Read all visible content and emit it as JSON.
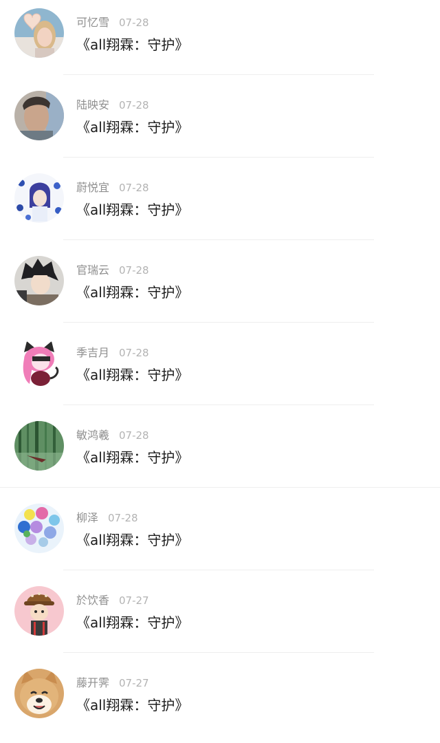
{
  "comments": [
    {
      "name": "可忆雪",
      "date": "07-28",
      "text": "《all翔霖：守护》",
      "avatar_icon": "girl-heart-hands-avatar"
    },
    {
      "name": "陆映安",
      "date": "07-28",
      "text": "《all翔霖：守护》",
      "avatar_icon": "boy-photo-avatar"
    },
    {
      "name": "蔚悦宜",
      "date": "07-28",
      "text": "《all翔霖：守护》",
      "avatar_icon": "anime-blue-butterflies-avatar"
    },
    {
      "name": "官瑞云",
      "date": "07-28",
      "text": "《all翔霖：守护》",
      "avatar_icon": "anime-dark-hair-boy-avatar"
    },
    {
      "name": "季吉月",
      "date": "07-28",
      "text": "《all翔霖：守护》",
      "avatar_icon": "pink-hair-cat-ears-avatar"
    },
    {
      "name": "敏鸿羲",
      "date": "07-28",
      "text": "《all翔霖：守护》",
      "avatar_icon": "green-forest-avatar"
    },
    {
      "name": "柳泽",
      "date": "07-28",
      "text": "《all翔霖：守护》",
      "avatar_icon": "balloons-avatar"
    },
    {
      "name": "於饮香",
      "date": "07-27",
      "text": "《all翔霖：守护》",
      "avatar_icon": "cartoon-boy-hat-avatar"
    },
    {
      "name": "藤开霁",
      "date": "07-27",
      "text": "《all翔霖：守护》",
      "avatar_icon": "shiba-dog-avatar"
    }
  ]
}
